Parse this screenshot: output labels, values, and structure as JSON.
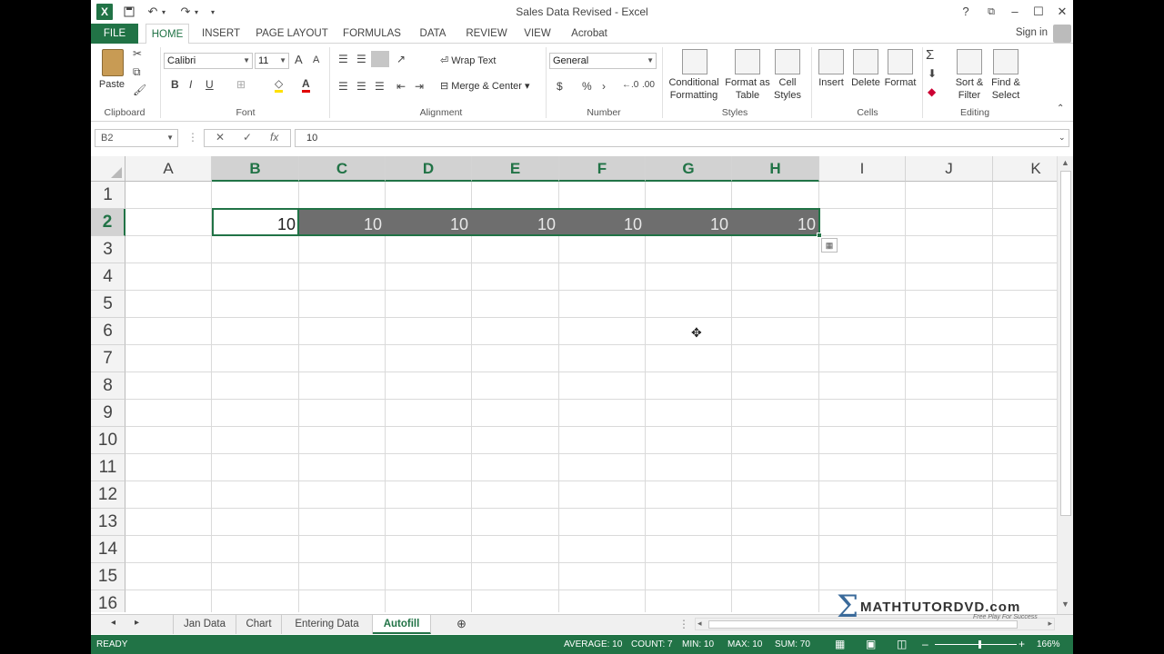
{
  "window": {
    "title": "Sales Data Revised - Excel",
    "help": "?",
    "min": "–",
    "max": "☐",
    "close": "✕",
    "ribbon_toggle": "⧉"
  },
  "qat": {
    "save": "💾",
    "undo": "↶",
    "redo": "↷",
    "customize": "▾"
  },
  "tabs": [
    {
      "label": "FILE"
    },
    {
      "label": "HOME"
    },
    {
      "label": "INSERT"
    },
    {
      "label": "PAGE LAYOUT"
    },
    {
      "label": "FORMULAS"
    },
    {
      "label": "DATA"
    },
    {
      "label": "REVIEW"
    },
    {
      "label": "VIEW"
    },
    {
      "label": "Acrobat"
    }
  ],
  "signin": "Sign in",
  "ribbon": {
    "clipboard": {
      "paste": "Paste",
      "label": "Clipboard"
    },
    "font": {
      "name": "Calibri",
      "size": "11",
      "bold": "B",
      "italic": "I",
      "underline": "U",
      "grow": "A",
      "shrink": "A",
      "label": "Font"
    },
    "alignment": {
      "wrap": "Wrap Text",
      "merge": "Merge & Center",
      "label": "Alignment"
    },
    "number": {
      "format": "General",
      "currency": "$",
      "percent": "%",
      "comma": "›",
      "label": "Number"
    },
    "styles": {
      "conditional_1": "Conditional",
      "conditional_2": "Formatting",
      "format_table_1": "Format as",
      "format_table_2": "Table",
      "cell_styles_1": "Cell",
      "cell_styles_2": "Styles",
      "label": "Styles"
    },
    "cells": {
      "insert": "Insert",
      "delete": "Delete",
      "format": "Format",
      "label": "Cells"
    },
    "editing": {
      "sort_1": "Sort &",
      "sort_2": "Filter",
      "find_1": "Find &",
      "find_2": "Select",
      "sigma": "Σ",
      "label": "Editing"
    }
  },
  "formula_bar": {
    "name_box": "B2",
    "cancel": "✕",
    "enter": "✓",
    "fx": "fx",
    "value": "10"
  },
  "grid": {
    "columns": [
      "A",
      "B",
      "C",
      "D",
      "E",
      "F",
      "G",
      "H",
      "I",
      "J",
      "K"
    ],
    "rows": [
      "1",
      "2",
      "3",
      "4",
      "5",
      "6",
      "7",
      "8",
      "9",
      "10",
      "11",
      "12",
      "13",
      "14",
      "15",
      "16"
    ],
    "row2_values": [
      "10",
      "10",
      "10",
      "10",
      "10",
      "10",
      "10"
    ]
  },
  "sheets": [
    {
      "label": "Jan Data"
    },
    {
      "label": "Chart"
    },
    {
      "label": "Entering Data"
    },
    {
      "label": "Autofill"
    }
  ],
  "status": {
    "mode": "READY",
    "average": "AVERAGE: 10",
    "count": "COUNT: 7",
    "min": "MIN: 10",
    "max": "MAX: 10",
    "sum": "SUM: 70",
    "zoom": "166%"
  },
  "watermark": {
    "text": "MATHTUTORDVD.com",
    "tagline": "Free Play For Success"
  }
}
